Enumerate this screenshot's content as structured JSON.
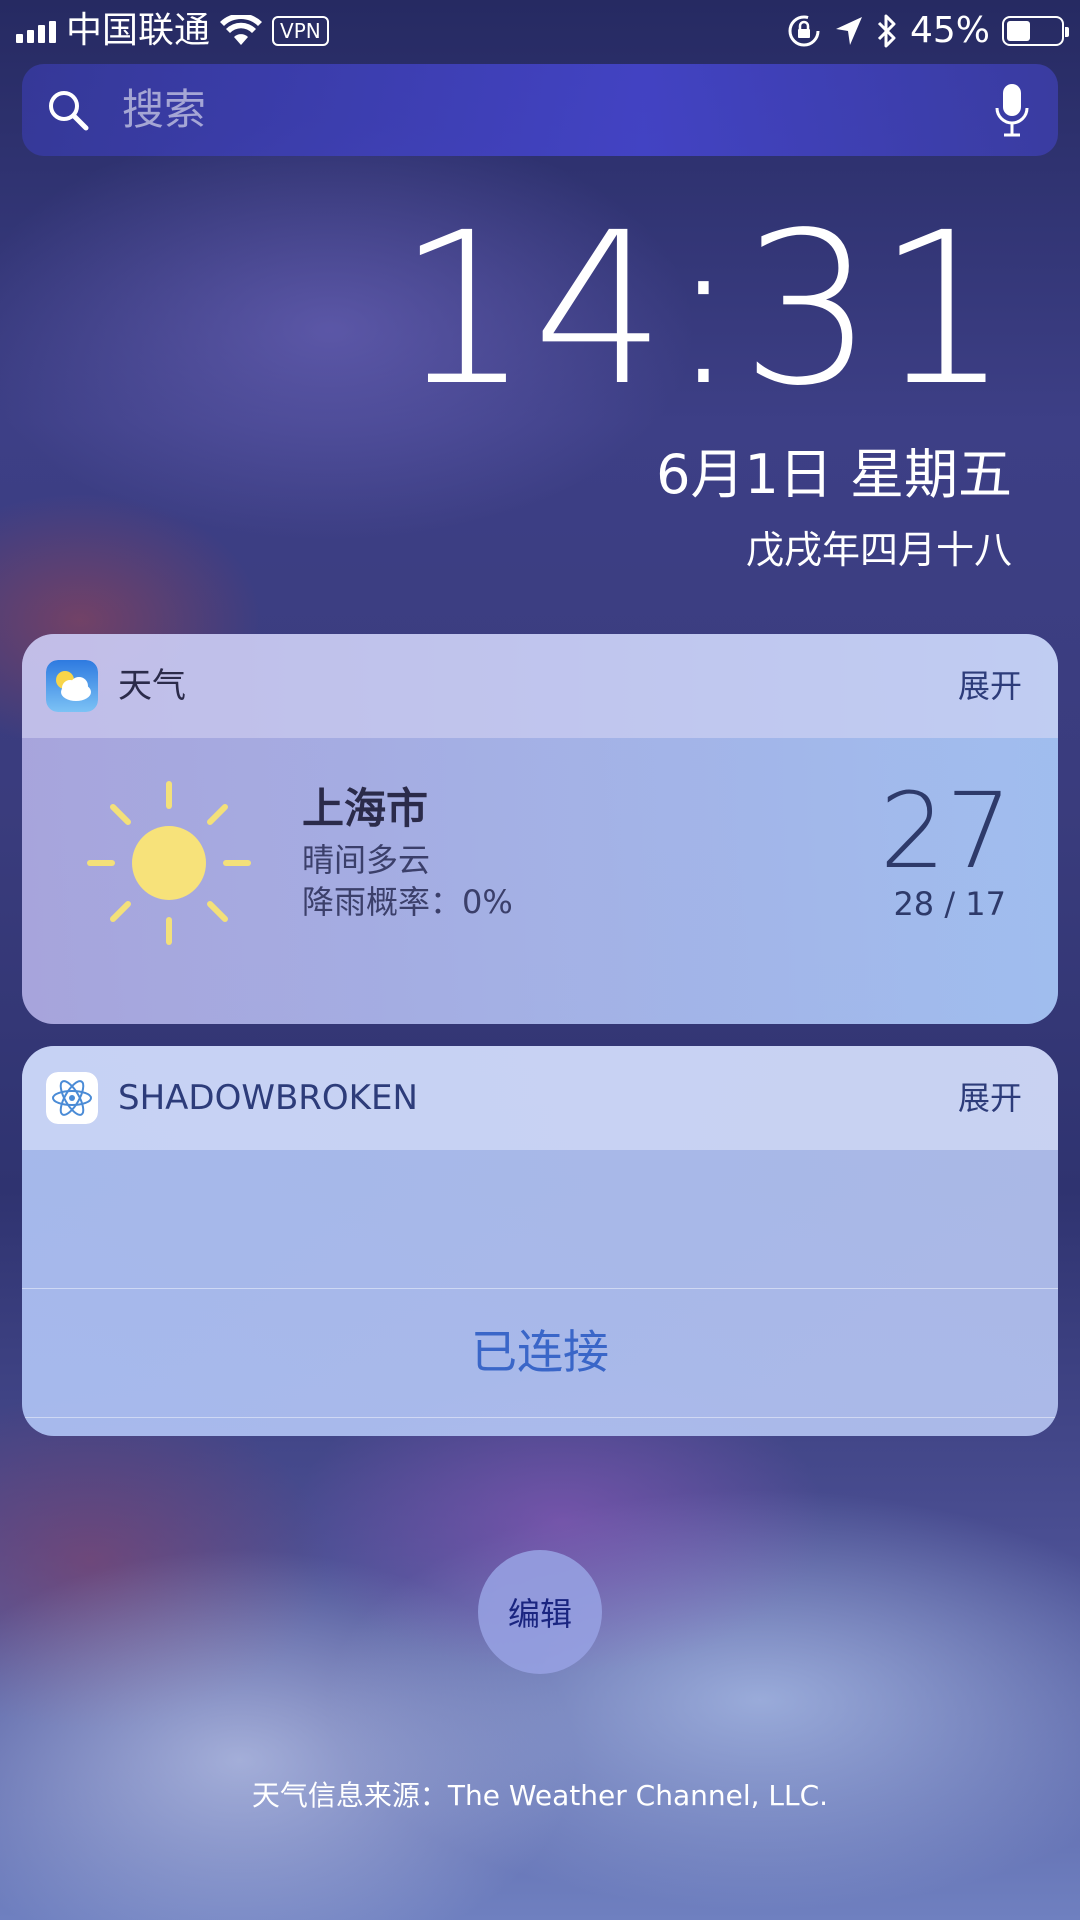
{
  "status_bar": {
    "carrier": "中国联通",
    "vpn": "VPN",
    "battery_percent": "45%",
    "battery_level": 0.45
  },
  "search": {
    "placeholder": "搜索"
  },
  "lockscreen": {
    "time": "14:31",
    "date": "6月1日 星期五",
    "lunar_date": "戊戌年四月十八"
  },
  "weather_widget": {
    "title": "天气",
    "expand_label": "展开",
    "city": "上海市",
    "condition": "晴间多云",
    "rain_chance": "降雨概率：0%",
    "temperature": "27",
    "temp_range": "28 / 17"
  },
  "shadowbroken_widget": {
    "title": "SHADOWBROKEN",
    "expand_label": "展开",
    "status": "已连接"
  },
  "edit_button": {
    "label": "编辑"
  },
  "footer": {
    "source": "天气信息来源：The Weather Channel, LLC."
  }
}
